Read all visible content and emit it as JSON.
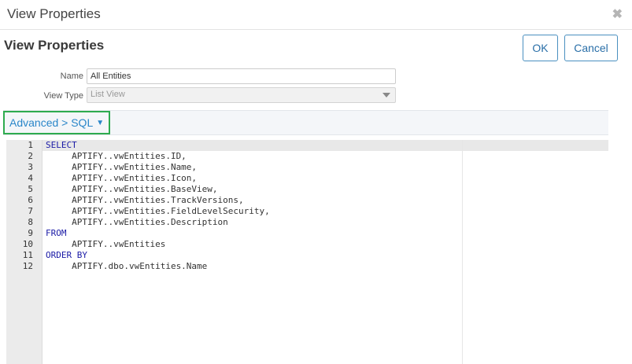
{
  "dialog": {
    "title": "View Properties",
    "close_icon": "close-icon"
  },
  "header": {
    "heading": "View Properties",
    "ok_label": "OK",
    "cancel_label": "Cancel"
  },
  "form": {
    "name_label": "Name",
    "name_value": "All Entities",
    "view_type_label": "View Type",
    "view_type_value": "List View"
  },
  "section": {
    "toggle_label": "Advanced > SQL",
    "toggle_icon": "caret-down-icon"
  },
  "editor": {
    "lines": [
      {
        "num": "1",
        "text": "SELECT",
        "keyword": true
      },
      {
        "num": "2",
        "text": "     APTIFY..vwEntities.ID,",
        "keyword": false
      },
      {
        "num": "3",
        "text": "     APTIFY..vwEntities.Name,",
        "keyword": false
      },
      {
        "num": "4",
        "text": "     APTIFY..vwEntities.Icon,",
        "keyword": false
      },
      {
        "num": "5",
        "text": "     APTIFY..vwEntities.BaseView,",
        "keyword": false
      },
      {
        "num": "6",
        "text": "     APTIFY..vwEntities.TrackVersions,",
        "keyword": false
      },
      {
        "num": "7",
        "text": "     APTIFY..vwEntities.FieldLevelSecurity,",
        "keyword": false
      },
      {
        "num": "8",
        "text": "     APTIFY..vwEntities.Description",
        "keyword": false
      },
      {
        "num": "9",
        "text": "FROM",
        "keyword": true
      },
      {
        "num": "10",
        "text": "     APTIFY..vwEntities",
        "keyword": false
      },
      {
        "num": "11",
        "text": "ORDER BY",
        "keyword": true
      },
      {
        "num": "12",
        "text": "     APTIFY.dbo.vwEntities.Name",
        "keyword": false
      }
    ]
  }
}
